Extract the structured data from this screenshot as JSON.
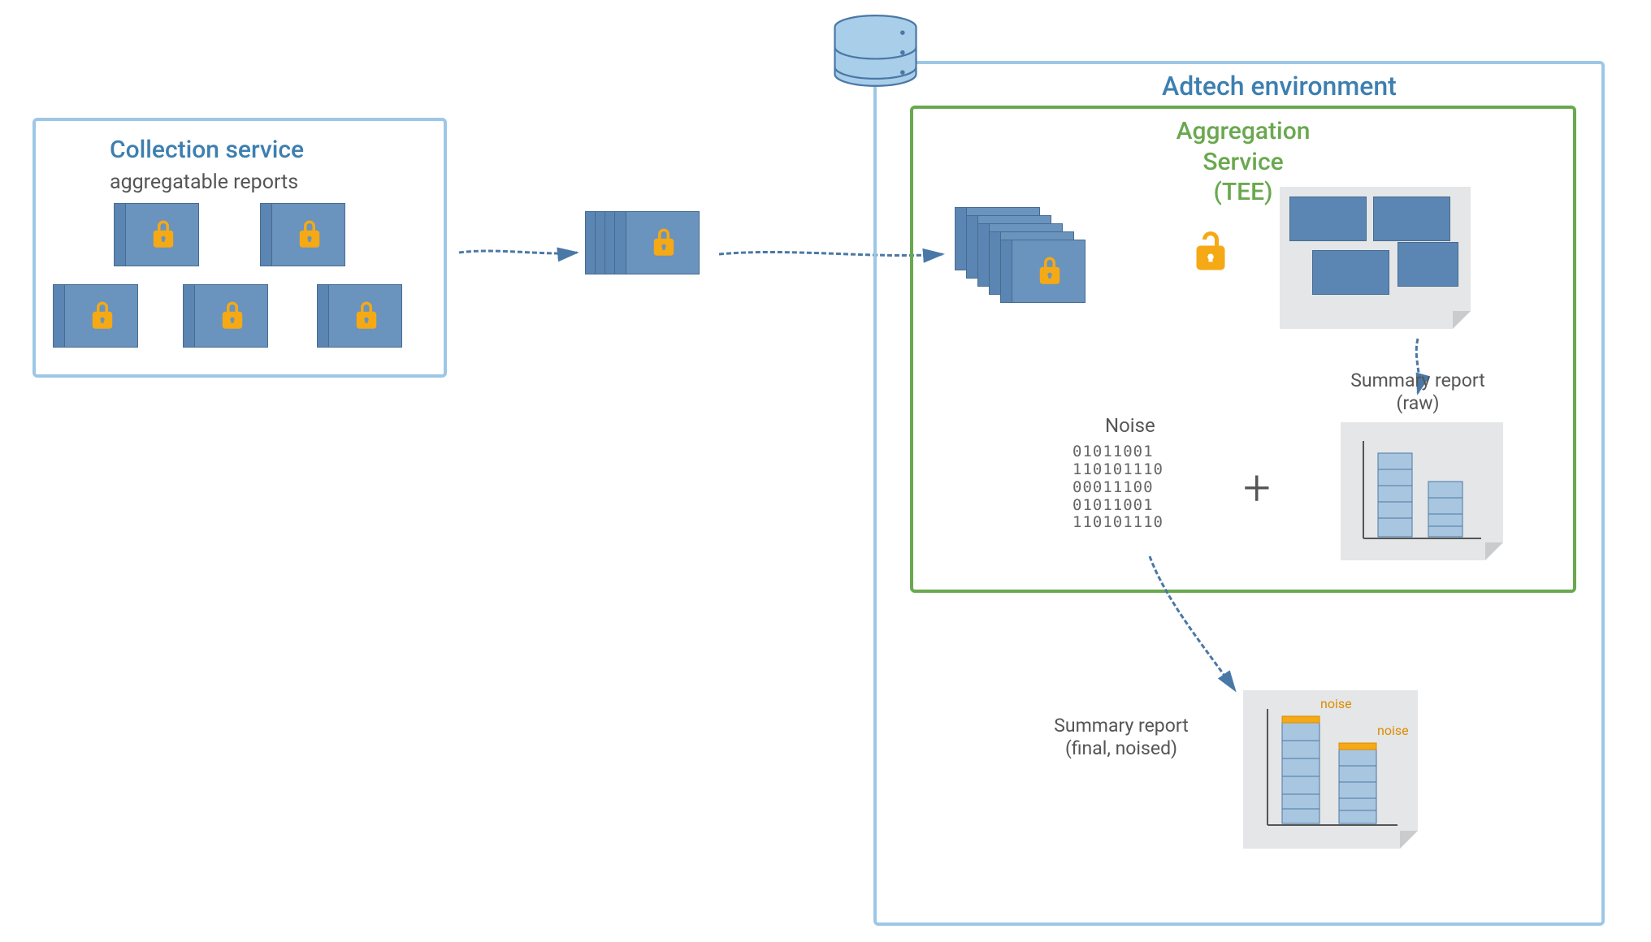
{
  "titles": {
    "collection": "Collection service",
    "adtech": "Adtech environment",
    "aggregation": "Aggregation Service\n(TEE)"
  },
  "labels": {
    "aggregatable_reports": "aggregatable reports",
    "noise_title": "Noise",
    "plus": "+",
    "summary_raw": "Summary report\n(raw)",
    "summary_final": "Summary report\n(final, noised)",
    "noise_tag": "noise"
  },
  "noise_bits": "01011001\n110101110\n00011100\n01011001\n110101110",
  "colors": {
    "border_light_blue": "#9cc7e6",
    "border_green": "#6aa84f",
    "folder_blue": "#6a93bd",
    "lock_orange": "#f4a915",
    "text_blue": "#3d7fb0"
  },
  "icons": {
    "lock": "lock-icon",
    "unlock": "unlock-icon",
    "database": "database-icon",
    "arrow": "arrow-icon",
    "chart": "chart-icon"
  }
}
